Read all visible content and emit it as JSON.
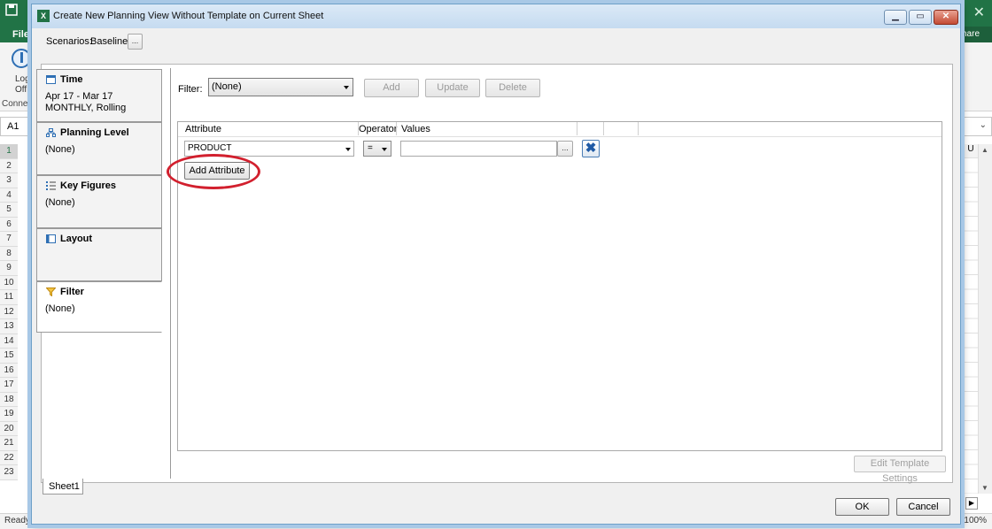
{
  "excel": {
    "file_tab": "File",
    "share": "hare",
    "logoff_line1": "Log",
    "logoff_line2": "Off",
    "connect": "Connec",
    "namebox": "A1",
    "column_u": "U",
    "rows": [
      "1",
      "2",
      "3",
      "4",
      "5",
      "6",
      "7",
      "8",
      "9",
      "10",
      "11",
      "12",
      "13",
      "14",
      "15",
      "16",
      "17",
      "18",
      "19",
      "20",
      "21",
      "22",
      "23"
    ],
    "status": "Ready",
    "zoom": "100%",
    "icons": [
      "save-icon",
      "excel-logo-icon",
      "logoff-icon",
      "close-icon"
    ]
  },
  "dialog": {
    "title": "Create New Planning View Without Template on Current Sheet",
    "scenarios_label": "Scenarios:",
    "scenarios_value": "Baseline",
    "ellipsis": "...",
    "nav": [
      {
        "title": "Time",
        "line1": "Apr 17 - Mar 17",
        "line2": "MONTHLY, Rolling",
        "icon": "calendar-icon"
      },
      {
        "title": "Planning Level",
        "line1": "(None)",
        "line2": "",
        "icon": "hierarchy-icon"
      },
      {
        "title": "Key Figures",
        "line1": "(None)",
        "line2": "",
        "icon": "list-icon"
      },
      {
        "title": "Layout",
        "line1": "",
        "line2": "",
        "icon": "layout-icon"
      },
      {
        "title": "Filter",
        "line1": "(None)",
        "line2": "",
        "icon": "funnel-icon",
        "active": true
      }
    ],
    "sheet_tab": "Sheet1",
    "filter": {
      "label": "Filter:",
      "selected": "(None)",
      "add": "Add",
      "update": "Update",
      "delete": "Delete"
    },
    "attributes": {
      "headers": {
        "attribute": "Attribute",
        "operator": "Operator",
        "values": "Values"
      },
      "row": {
        "attribute": "PRODUCT",
        "operator": "=",
        "values": ""
      },
      "add_attribute": "Add Attribute"
    },
    "edit_template_settings": "Edit Template Settings",
    "ok": "OK",
    "cancel": "Cancel",
    "highlight_color": "#d2202e"
  }
}
